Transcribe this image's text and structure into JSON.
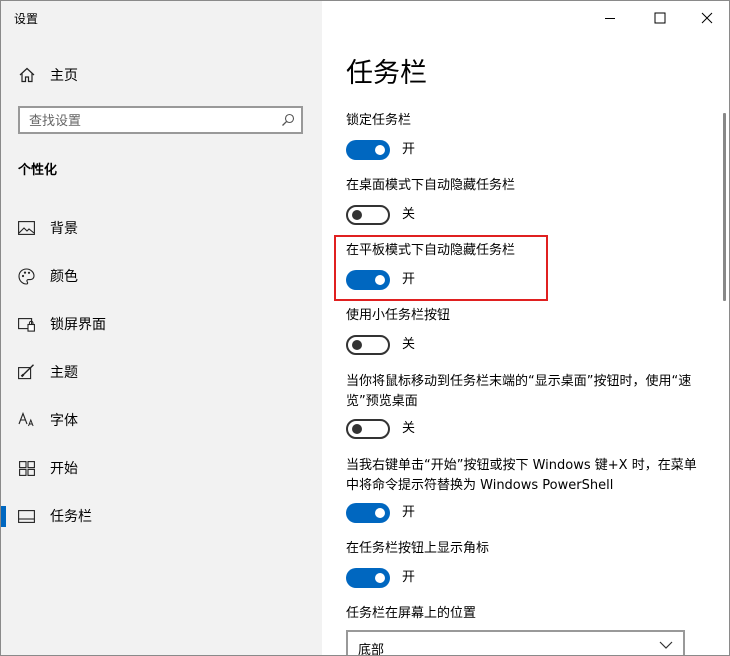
{
  "window": {
    "title": "设置"
  },
  "sidebar": {
    "home_label": "主页",
    "search_placeholder": "查找设置",
    "section_title": "个性化",
    "items": [
      {
        "label": "背景",
        "icon": "picture-icon"
      },
      {
        "label": "颜色",
        "icon": "palette-icon"
      },
      {
        "label": "锁屏界面",
        "icon": "lock-screen-icon"
      },
      {
        "label": "主题",
        "icon": "theme-icon"
      },
      {
        "label": "字体",
        "icon": "font-icon"
      },
      {
        "label": "开始",
        "icon": "start-icon"
      },
      {
        "label": "任务栏",
        "icon": "taskbar-icon",
        "active": true
      }
    ]
  },
  "main": {
    "title": "任务栏",
    "settings": [
      {
        "label": "锁定任务栏",
        "state": "开",
        "on": true
      },
      {
        "label": "在桌面模式下自动隐藏任务栏",
        "state": "关",
        "on": false
      },
      {
        "label": "在平板模式下自动隐藏任务栏",
        "state": "开",
        "on": true,
        "highlighted": true
      },
      {
        "label": "使用小任务栏按钮",
        "state": "关",
        "on": false
      },
      {
        "label": "当你将鼠标移动到任务栏末端的“显示桌面”按钮时，使用“速览”预览桌面",
        "state": "关",
        "on": false
      },
      {
        "label": "当我右键单击“开始”按钮或按下 Windows 键+X 时，在菜单中将命令提示符替换为 Windows PowerShell",
        "state": "开",
        "on": true
      },
      {
        "label": "在任务栏按钮上显示角标",
        "state": "开",
        "on": true
      }
    ],
    "position_label": "任务栏在屏幕上的位置",
    "position_value": "底部"
  },
  "colors": {
    "accent": "#0067c0",
    "highlight_border": "#e02020",
    "sidebar_bg": "#f2f2f2"
  }
}
